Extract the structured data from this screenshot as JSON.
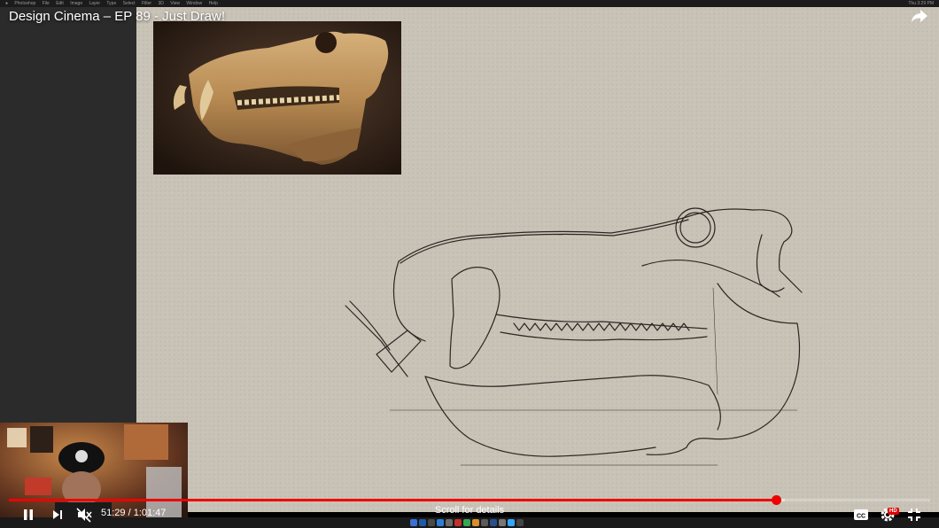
{
  "video": {
    "title": "Design Cinema – EP 89 - Just Draw!",
    "time_current": "51:29",
    "time_separator": " / ",
    "time_total": "1:01:47",
    "progress_played": 0.833,
    "progress_loaded": 0.842,
    "scroll_hint": "Scroll for details",
    "hd_badge": "HD"
  },
  "mac_menubar": {
    "app": "Photoshop",
    "menus": [
      "File",
      "Edit",
      "Image",
      "Layer",
      "Type",
      "Select",
      "Filter",
      "3D",
      "View",
      "Window",
      "Help"
    ],
    "right_text": "Thu 3:29 PM"
  },
  "icons": {
    "share": "share-icon",
    "pause": "pause-icon",
    "next": "next-icon",
    "mute": "volume-muted-icon",
    "captions": "captions-icon",
    "settings": "gear-icon",
    "exit_fullscreen": "exit-fullscreen-icon"
  },
  "colors": {
    "progress_played": "#ee0000",
    "canvas": "#c9c3b7",
    "hd_badge": "#e00000"
  }
}
